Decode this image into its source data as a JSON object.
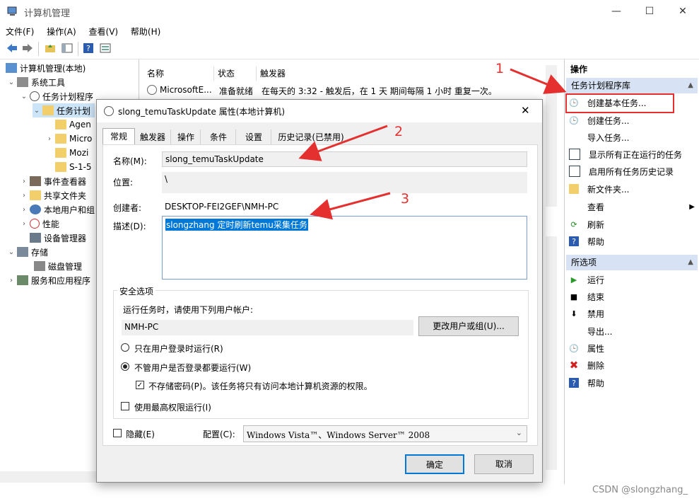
{
  "window": {
    "title": "计算机管理",
    "min_icon": "—",
    "max_icon": "☐",
    "close_icon": "✕"
  },
  "menu": [
    "文件(F)",
    "操作(A)",
    "查看(V)",
    "帮助(H)"
  ],
  "tree": {
    "root": "计算机管理(本地)",
    "system_tools": "系统工具",
    "task_scheduler": "任务计划程序",
    "task_library": "任务计划",
    "lib_children": [
      "Agen",
      "Micro",
      "Mozi",
      "S-1-5"
    ],
    "event_viewer": "事件查看器",
    "shared_folders": "共享文件夹",
    "local_users": "本地用户和组",
    "performance": "性能",
    "device_manager": "设备管理器",
    "storage": "存储",
    "disk_mgmt": "磁盘管理",
    "services": "服务和应用程序"
  },
  "list": {
    "columns": [
      "名称",
      "状态",
      "触发器"
    ],
    "rows": [
      {
        "name": "MicrosoftE...",
        "status": "准备就绪",
        "trigger": "在每天的 3:32 - 触发后，在 1 天 期间每隔 1 小时 重复一次。"
      }
    ]
  },
  "actions": {
    "header": "操作",
    "section1": "任务计划程序库",
    "items1": [
      "创建基本任务...",
      "创建任务...",
      "导入任务...",
      "显示所有正在运行的任务",
      "启用所有任务历史记录",
      "新文件夹...",
      "查看",
      "刷新",
      "帮助"
    ],
    "section2": "所选项",
    "items2": [
      "运行",
      "结束",
      "禁用",
      "导出...",
      "属性",
      "删除",
      "帮助"
    ]
  },
  "dialog": {
    "title": "slong_temuTaskUpdate 属性(本地计算机)",
    "close": "✕",
    "tabs": [
      "常规",
      "触发器",
      "操作",
      "条件",
      "设置",
      "历史记录(已禁用)"
    ],
    "name_label": "名称(M):",
    "name_value": "slong_temuTaskUpdate",
    "location_label": "位置:",
    "location_value": "\\",
    "author_label": "创建者:",
    "author_value": "DESKTOP-FEI2GEF\\NMH-PC",
    "desc_label": "描述(D):",
    "desc_value": "slongzhang 定时刷新temu采集任务",
    "security_group": "安全选项",
    "run_as_label": "运行任务时，请使用下列用户帐户:",
    "run_as_value": "NMH-PC",
    "change_user_btn": "更改用户或组(U)...",
    "radio1": "只在用户登录时运行(R)",
    "radio2": "不管用户是否登录都要运行(W)",
    "no_store_pwd": "不存储密码(P)。该任务将只有访问本地计算机资源的权限。",
    "highest_priv": "使用最高权限运行(I)",
    "hidden": "隐藏(E)",
    "config_label": "配置(C):",
    "config_value": "Windows Vista™、Windows Server™ 2008",
    "ok": "确定",
    "cancel": "取消"
  },
  "annotations": [
    "1",
    "2",
    "3"
  ],
  "watermark": "CSDN @slongzhang_",
  "colors": {
    "accent_red": "#e53030",
    "selection": "#0078d7",
    "section_bg": "#d7e3f4"
  }
}
